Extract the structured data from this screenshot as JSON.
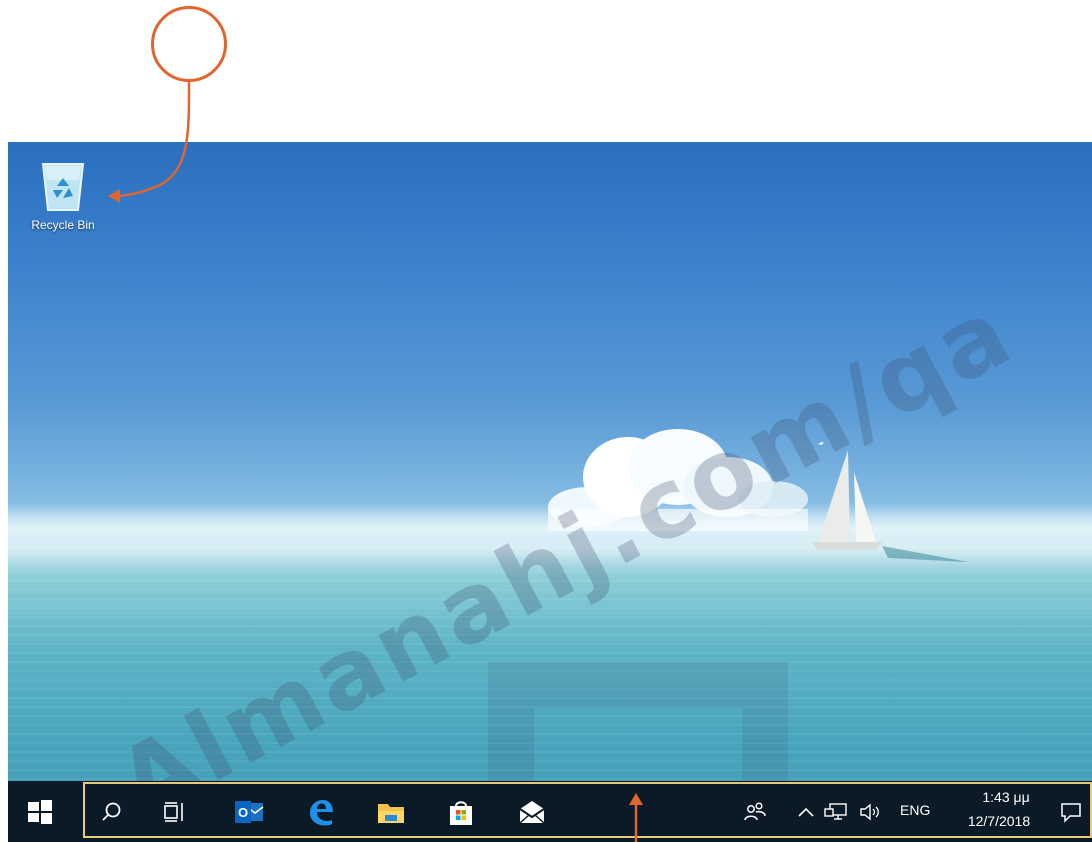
{
  "desktop": {
    "icons": [
      {
        "label": "Recycle Bin",
        "icon": "recycle-bin-icon"
      }
    ],
    "watermark_text": "Almanahj.com/qa"
  },
  "taskbar": {
    "start": "windows-start-icon",
    "pinned": [
      {
        "name": "search",
        "icon": "search-icon"
      },
      {
        "name": "task-view",
        "icon": "task-view-icon"
      },
      {
        "name": "outlook",
        "icon": "outlook-icon"
      },
      {
        "name": "edge",
        "icon": "edge-icon"
      },
      {
        "name": "file-explorer",
        "icon": "folder-icon"
      },
      {
        "name": "store",
        "icon": "store-bag-icon"
      },
      {
        "name": "mail",
        "icon": "mail-icon"
      }
    ],
    "tray": {
      "people_icon": "people-icon",
      "chevron_icon": "chevron-up-icon",
      "network_icon": "network-icon",
      "volume_icon": "volume-icon",
      "language": "ENG",
      "time": "1:43 μμ",
      "date": "12/7/2018",
      "notifications_icon": "action-center-icon"
    }
  },
  "annotations": {
    "accent_color": "#e0652e",
    "highlight_color": "#e8c977"
  }
}
